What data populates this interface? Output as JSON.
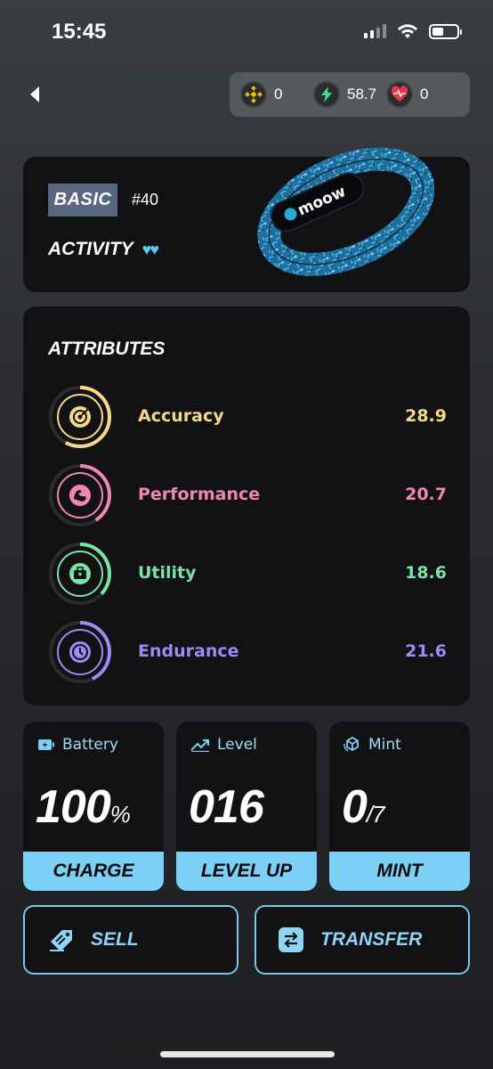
{
  "status": {
    "time": "15:45"
  },
  "balances": [
    {
      "icon": "bnb-coin-icon",
      "value": "0"
    },
    {
      "icon": "energy-coin-icon",
      "value": "58.7"
    },
    {
      "icon": "health-coin-icon",
      "value": "0"
    }
  ],
  "nft": {
    "tier": "BASIC",
    "id": "#40",
    "activity_label": "ACTIVITY",
    "hearts": "♥♥",
    "brand": "moow"
  },
  "attributes": {
    "title": "ATTRIBUTES",
    "items": [
      {
        "name": "Accuracy",
        "value": "28.9",
        "color": "#f5d98a",
        "fraction": 0.58
      },
      {
        "name": "Performance",
        "value": "20.7",
        "color": "#ef87b1",
        "fraction": 0.41
      },
      {
        "name": "Utility",
        "value": "18.6",
        "color": "#7be3a6",
        "fraction": 0.37
      },
      {
        "name": "Endurance",
        "value": "21.6",
        "color": "#9a8cf2",
        "fraction": 0.43
      }
    ]
  },
  "stats": {
    "battery": {
      "label": "Battery",
      "value": "100",
      "unit": "%",
      "button": "CHARGE"
    },
    "level": {
      "label": "Level",
      "value": "016",
      "button": "LEVEL UP"
    },
    "mint": {
      "label": "Mint",
      "value": "0",
      "unit": "/7",
      "button": "MINT"
    }
  },
  "actions": {
    "sell": "SELL",
    "transfer": "TRANSFER"
  },
  "colors": {
    "accent": "#7cd0f5",
    "card": "#121214"
  }
}
